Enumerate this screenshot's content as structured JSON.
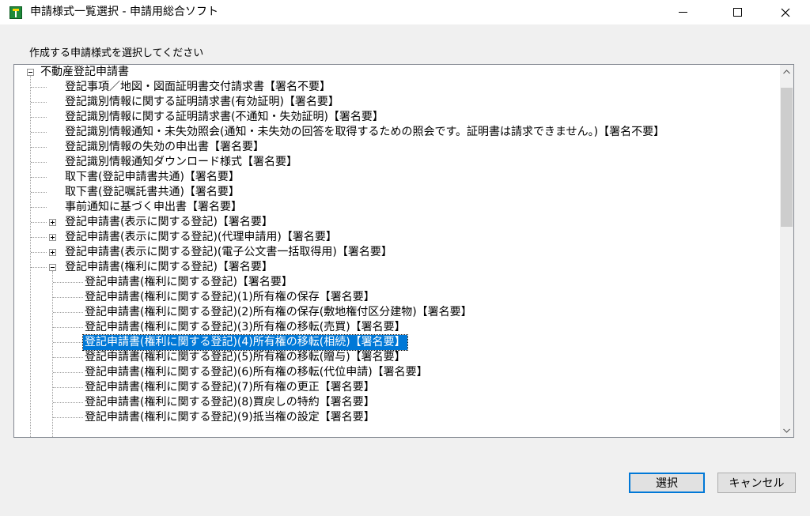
{
  "window": {
    "title": "申請様式一覧選択 - 申請用総合ソフト",
    "controls": {
      "minimize": "minimize",
      "maximize": "maximize",
      "close": "close"
    }
  },
  "prompt": "作成する申請様式を選択してください",
  "tree": {
    "root_label": "不動産登記申請書",
    "items": [
      "登記事項／地図・図面証明書交付請求書【署名不要】",
      "登記識別情報に関する証明請求書(有効証明)【署名要】",
      "登記識別情報に関する証明請求書(不通知・失効証明)【署名要】",
      "登記識別情報通知・未失効照会(通知・未失効の回答を取得するための照会です。証明書は請求できません。)【署名不要】",
      "登記識別情報の失効の申出書【署名要】",
      "登記識別情報通知ダウンロード様式【署名要】",
      "取下書(登記申請書共通)【署名要】",
      "取下書(登記嘱託書共通)【署名要】",
      "事前通知に基づく申出書【署名要】",
      "登記申請書(表示に関する登記)【署名要】",
      "登記申請書(表示に関する登記)(代理申請用)【署名要】",
      "登記申請書(表示に関する登記)(電子公文書一括取得用)【署名要】",
      "登記申請書(権利に関する登記)【署名要】"
    ],
    "children": [
      "登記申請書(権利に関する登記)【署名要】",
      "登記申請書(権利に関する登記)(1)所有権の保存【署名要】",
      "登記申請書(権利に関する登記)(2)所有権の保存(敷地権付区分建物)【署名要】",
      "登記申請書(権利に関する登記)(3)所有権の移転(売買)【署名要】",
      "登記申請書(権利に関する登記)(4)所有権の移転(相続)【署名要】",
      "登記申請書(権利に関する登記)(5)所有権の移転(贈与)【署名要】",
      "登記申請書(権利に関する登記)(6)所有権の移転(代位申請)【署名要】",
      "登記申請書(権利に関する登記)(7)所有権の更正【署名要】",
      "登記申請書(権利に関する登記)(8)買戻しの特約【署名要】",
      "登記申請書(権利に関する登記)(9)抵当権の設定【署名要】"
    ],
    "selected_child_index": 4
  },
  "buttons": {
    "select": "選択",
    "cancel": "キャンセル"
  },
  "icons": {
    "app": "app-icon",
    "scroll_up": "chevron-up-icon",
    "scroll_down": "chevron-down-icon"
  }
}
